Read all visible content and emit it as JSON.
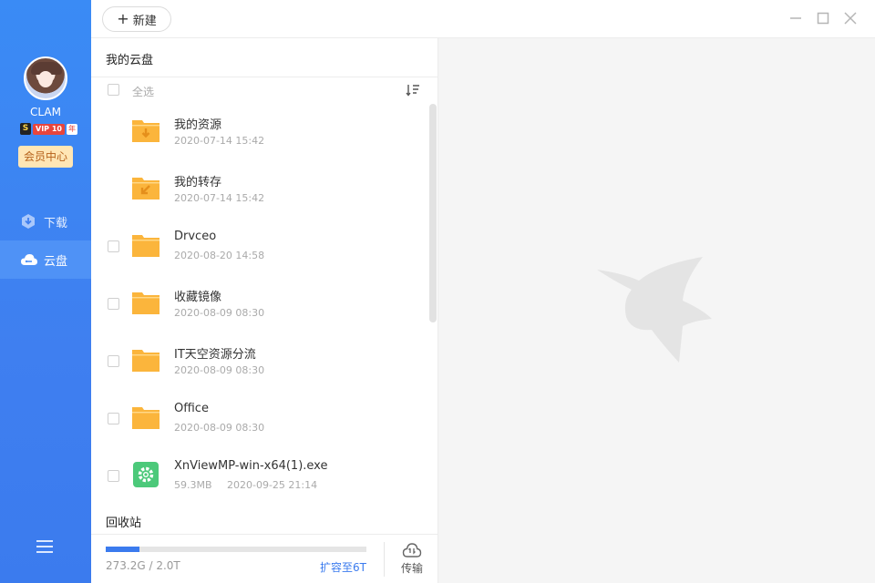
{
  "user": {
    "name": "CLAM",
    "vip_s": "S",
    "vip_tag": "VIP 10",
    "vip_year": "年",
    "member_button": "会员中心"
  },
  "nav": [
    {
      "label": "下载",
      "icon": "download-icon",
      "active": false
    },
    {
      "label": "云盘",
      "icon": "cloud-icon",
      "active": true
    }
  ],
  "topbar": {
    "new_label": "新建"
  },
  "panel": {
    "title": "我的云盘",
    "select_all": "全选",
    "recycle_bin": "回收站"
  },
  "files": [
    {
      "name": "我的资源",
      "date": "2020-07-14 15:42",
      "icon": "folder-download-icon"
    },
    {
      "name": "我的转存",
      "date": "2020-07-14 15:42",
      "icon": "folder-transfer-icon"
    },
    {
      "name": "Drvceo",
      "date": "2020-08-20 14:58",
      "icon": "folder-icon"
    },
    {
      "name": "收藏镜像",
      "date": "2020-08-09 08:30",
      "icon": "folder-icon"
    },
    {
      "name": "IT天空资源分流",
      "date": "2020-08-09 08:30",
      "icon": "folder-icon"
    },
    {
      "name": "Office",
      "date": "2020-08-09 08:30",
      "icon": "folder-icon"
    },
    {
      "name": "XnViewMP-win-x64(1).exe",
      "size": "59.3MB",
      "date": "2020-09-25 21:14",
      "icon": "exe-gear-icon"
    }
  ],
  "storage": {
    "usage": "273.2G / 2.0T",
    "used_fraction": 0.13,
    "expand": "扩容至6T",
    "transfer": "传输"
  },
  "colors": {
    "accent": "#3b7bee",
    "folder": "#fbb53c",
    "exe": "#4cc97a"
  }
}
